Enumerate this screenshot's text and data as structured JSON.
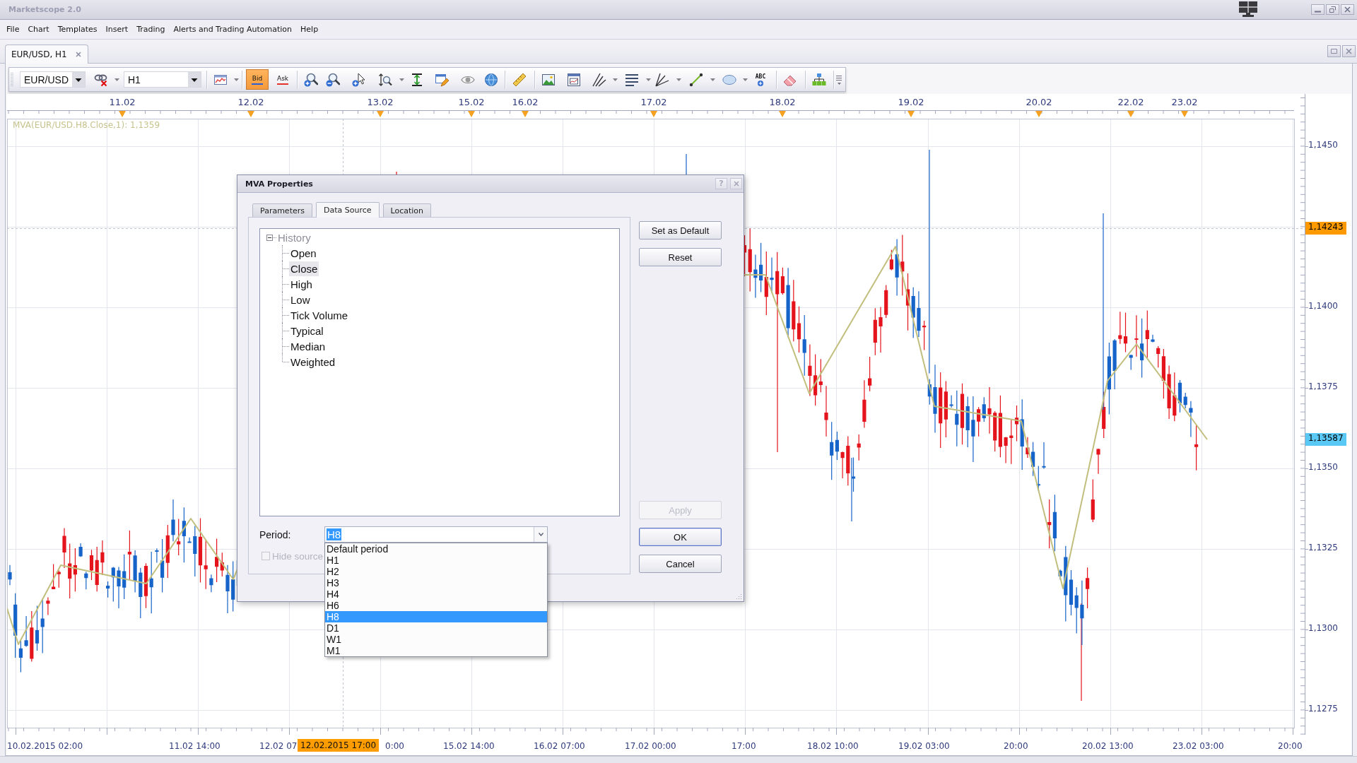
{
  "window": {
    "title": "Marketscope 2.0"
  },
  "menu": [
    "File",
    "Chart",
    "Templates",
    "Insert",
    "Trading",
    "Alerts and Trading Automation",
    "Help"
  ],
  "document_tabs": [
    {
      "label": "EUR/USD, H1",
      "selected": true
    }
  ],
  "toolbar": {
    "symbol": "EUR/USD",
    "timeframe": "H1",
    "price_buttons": [
      {
        "label": "Bid",
        "selected": true,
        "color": "#2a5fd6"
      },
      {
        "label": "Ask",
        "selected": false,
        "color": "#e3322c"
      }
    ],
    "text_tool": "ABC"
  },
  "chart": {
    "legend": "MVA(EUR/USD.H8.Close,1): 1,1359",
    "top_axis": [
      "11.02",
      "12.02",
      "13.02",
      "15.02",
      "16.02",
      "17.02",
      "18.02",
      "19.02",
      "20.02",
      "22.02",
      "23.02"
    ],
    "price_axis": [
      {
        "label": "1,1450",
        "kind": "tick"
      },
      {
        "label": "1,14243",
        "kind": "badge",
        "color": "#ff9900"
      },
      {
        "label": "1,1400",
        "kind": "tick"
      },
      {
        "label": "1,1375",
        "kind": "tick"
      },
      {
        "label": "1,13587",
        "kind": "badge",
        "color": "#5ac8f5"
      },
      {
        "label": "1,1350",
        "kind": "tick"
      },
      {
        "label": "1,1325",
        "kind": "tick"
      },
      {
        "label": "1,1300",
        "kind": "tick"
      },
      {
        "label": "1,1275",
        "kind": "tick"
      }
    ],
    "time_axis": [
      {
        "label": "10.02.2015 02:00",
        "kind": "tick"
      },
      {
        "label": "11.02 14:00",
        "kind": "tick"
      },
      {
        "label": "12.02 07",
        "kind": "tick"
      },
      {
        "label": "12.02.2015 17:00",
        "kind": "badge"
      },
      {
        "label": "0:00",
        "kind": "tick"
      },
      {
        "label": "15.02 14:00",
        "kind": "tick"
      },
      {
        "label": "16.02 07:00",
        "kind": "tick"
      },
      {
        "label": "17.02 00:00",
        "kind": "tick"
      },
      {
        "label": "17:00",
        "kind": "tick"
      },
      {
        "label": "18.02 10:00",
        "kind": "tick"
      },
      {
        "label": "19.02 03:00",
        "kind": "tick"
      },
      {
        "label": "20:00",
        "kind": "tick"
      },
      {
        "label": "20.02 13:00",
        "kind": "tick"
      },
      {
        "label": "23.02 03:00",
        "kind": "tick"
      },
      {
        "label": "20:00",
        "kind": "tick"
      }
    ]
  },
  "dialog": {
    "title": "MVA Properties",
    "help_button": "?",
    "tabs": [
      {
        "label": "Parameters",
        "selected": false
      },
      {
        "label": "Data Source",
        "selected": true
      },
      {
        "label": "Location",
        "selected": false
      }
    ],
    "tree": [
      {
        "label": "History",
        "expanded": true,
        "disabled": true,
        "selected": false,
        "children": [
          {
            "label": "Open",
            "selected": false,
            "disabled": false
          },
          {
            "label": "Close",
            "selected": true,
            "disabled": false
          },
          {
            "label": "High",
            "selected": false,
            "disabled": false
          },
          {
            "label": "Low",
            "selected": false,
            "disabled": false
          },
          {
            "label": "Tick Volume",
            "selected": false,
            "disabled": false
          },
          {
            "label": "Typical",
            "selected": false,
            "disabled": false
          },
          {
            "label": "Median",
            "selected": false,
            "disabled": false
          },
          {
            "label": "Weighted",
            "selected": false,
            "disabled": false
          }
        ]
      }
    ],
    "period": {
      "label": "Period:",
      "value": "H8",
      "open": true,
      "options": [
        {
          "label": "Default period",
          "selected": false
        },
        {
          "label": "H1",
          "selected": false
        },
        {
          "label": "H2",
          "selected": false
        },
        {
          "label": "H3",
          "selected": false
        },
        {
          "label": "H4",
          "selected": false
        },
        {
          "label": "H6",
          "selected": false
        },
        {
          "label": "H8",
          "selected": true
        },
        {
          "label": "D1",
          "selected": false
        },
        {
          "label": "W1",
          "selected": false
        },
        {
          "label": "M1",
          "selected": false
        }
      ]
    },
    "hide_source": {
      "label": "Hide source",
      "checked": false,
      "disabled": true
    },
    "side_buttons": [
      {
        "label": "Set as Default",
        "disabled": false,
        "default": false
      },
      {
        "label": "Reset",
        "disabled": false,
        "default": false
      }
    ],
    "action_buttons": [
      {
        "label": "Apply",
        "disabled": true,
        "default": false
      },
      {
        "label": "OK",
        "disabled": false,
        "default": true
      },
      {
        "label": "Cancel",
        "disabled": false,
        "default": false
      }
    ]
  }
}
